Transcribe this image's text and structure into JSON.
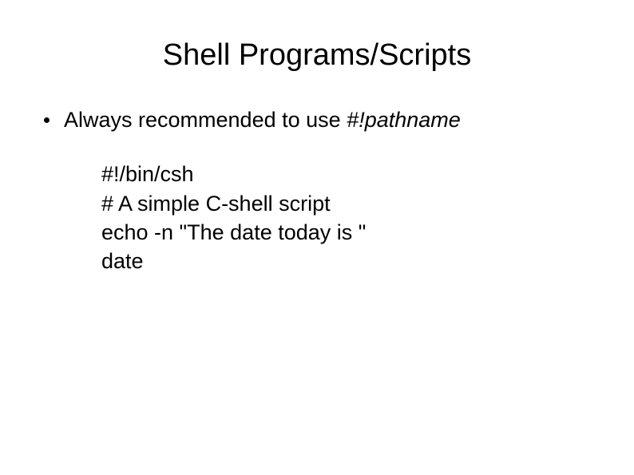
{
  "slide": {
    "title": "Shell Programs/Scripts",
    "bullet": {
      "text_prefix": "Always recommended to use ",
      "text_italic": "#!pathname"
    },
    "code": {
      "line1": "#!/bin/csh",
      "line2": "# A simple C-shell script",
      "line3": "echo -n \"The date today is \"",
      "line4": "date"
    }
  }
}
